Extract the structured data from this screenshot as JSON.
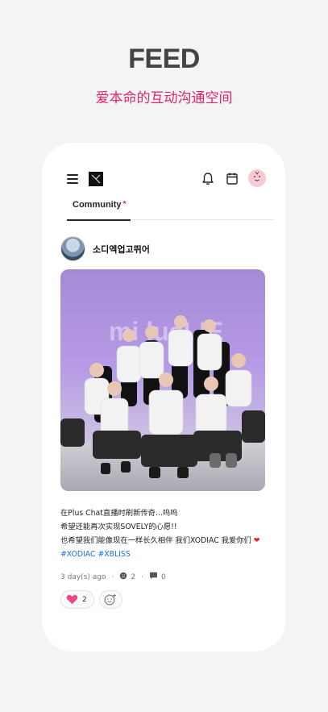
{
  "hero": {
    "title": "FEED",
    "subtitle": "爱本命的互动沟通空间"
  },
  "topbar": {
    "icons": [
      "menu-icon",
      "app-logo",
      "bell-icon",
      "calendar-icon",
      "profile-avatar"
    ]
  },
  "tabs": [
    {
      "label": "Community",
      "badge": "*"
    }
  ],
  "post": {
    "author": "소디엑업고뛰어",
    "image_caption_overlay": "",
    "lines": [
      "在Plus Chat直播时刷新传奇...呜呜",
      "希望还能再次实现SOVELY的心愿!!",
      "也希望我们能像现在一样长久相伴 我们XODIAC 我爱你们"
    ],
    "hashtags": [
      "#XODIAC",
      "#XBLISS"
    ],
    "time": "3 day(s) ago",
    "commenter_count": "2",
    "comment_count": "0",
    "like_count": "2"
  },
  "colors": {
    "accent": "#e0246e",
    "hashtag": "#1c6fd0",
    "heart": "#e94b86"
  }
}
